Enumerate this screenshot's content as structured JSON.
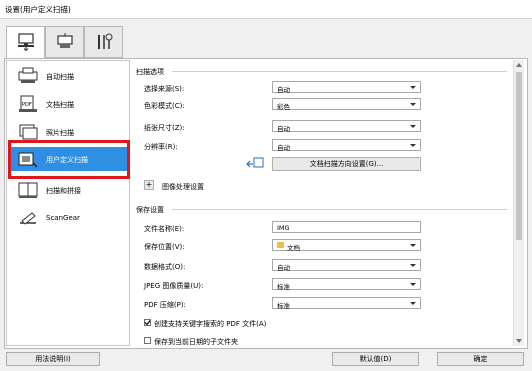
{
  "window": {
    "title": "设置(用户定义扫描)"
  },
  "top_tabs": [
    {
      "icon": "scan-from-computer-icon"
    },
    {
      "icon": "scan-from-panel-icon"
    },
    {
      "icon": "tools-icon"
    }
  ],
  "sidebar": {
    "items": [
      {
        "label": "自动扫描",
        "icon": "auto-scan-icon"
      },
      {
        "label": "文档扫描",
        "icon": "document-scan-icon"
      },
      {
        "label": "照片扫描",
        "icon": "photo-scan-icon"
      },
      {
        "label": "用户定义扫描",
        "icon": "custom-scan-icon",
        "selected": true
      },
      {
        "label": "扫描和拼接",
        "icon": "scan-stitch-icon"
      },
      {
        "label": "ScanGear",
        "icon": "scangear-icon"
      }
    ]
  },
  "scan_options": {
    "heading": "扫描选项",
    "rows": [
      {
        "label": "选择来源(S):",
        "value": "自动"
      },
      {
        "label": "色彩模式(C):",
        "value": "彩色"
      },
      {
        "label": "纸张尺寸(Z):",
        "value": "自动"
      },
      {
        "label": "分辨率(R):",
        "value": "自动"
      }
    ],
    "orientation_button": "文档扫描方向设置(G)...",
    "image_processing": "图像处理设置"
  },
  "save_settings": {
    "heading": "保存设置",
    "rows": [
      {
        "label": "文件名称(E):",
        "value": "IMG"
      },
      {
        "label": "保存位置(V):",
        "value": "文档"
      },
      {
        "label": "数据格式(O):",
        "value": "自动"
      },
      {
        "label": "JPEG 图像质量(U):",
        "value": "标准"
      },
      {
        "label": "PDF 压缩(P):",
        "value": "标准"
      }
    ],
    "checkbox1": "创建支持关键字搜索的 PDF 文件(A)",
    "checkbox2": "保存到当前日期的子文件夹"
  },
  "footer": {
    "help": "用法说明(I)",
    "defaults": "默认值(D)",
    "ok": "确定"
  },
  "colors": {
    "selected": "#2e8fe3",
    "highlight_border": "#e0161b"
  }
}
